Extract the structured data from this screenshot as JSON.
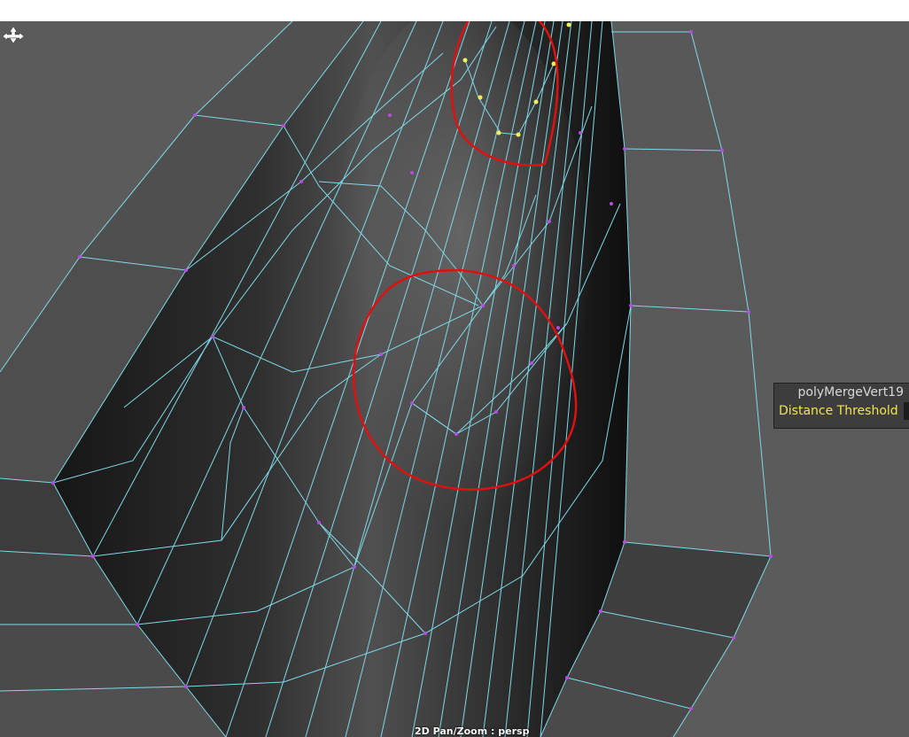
{
  "viewport": {
    "background": "#5b5b5b",
    "wire_color": "#7fd9e8",
    "vertex_color": "#b64ce8",
    "selected_vertex_color": "#f2f05a",
    "annotation_color": "#e01010"
  },
  "hud": {
    "node_name": "polyMergeVert19",
    "attribute_label": "Distance Threshold",
    "label_color": "#f2e44a"
  },
  "status_text": "2D Pan/Zoom : persp",
  "cursor": {
    "icon": "move-cursor-icon"
  }
}
